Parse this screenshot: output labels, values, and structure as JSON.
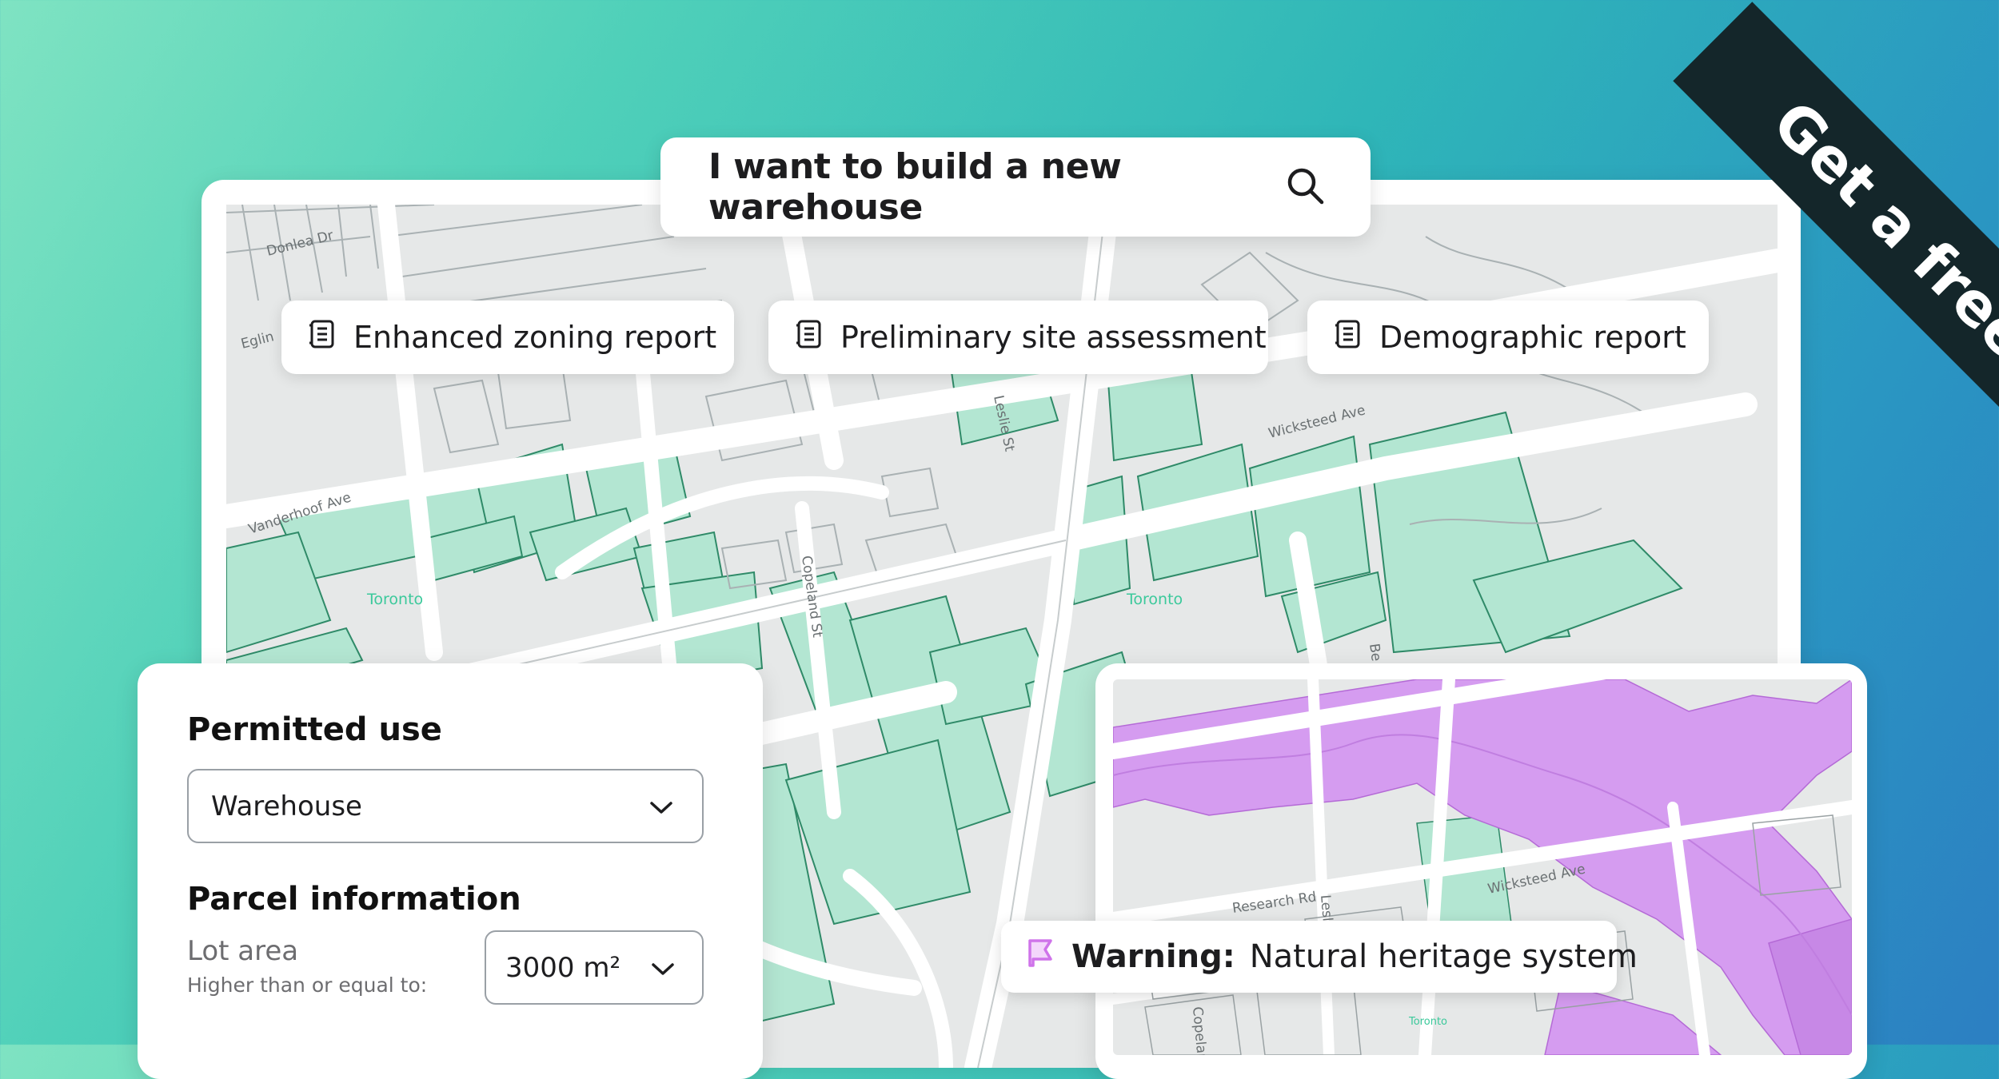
{
  "search": {
    "query": "I want to build a new warehouse",
    "icon": "search-icon"
  },
  "reports": [
    {
      "label": "Enhanced zoning report",
      "icon": "report-icon"
    },
    {
      "label": "Preliminary site assessment",
      "icon": "report-icon"
    },
    {
      "label": "Demographic report",
      "icon": "report-icon"
    }
  ],
  "banner": {
    "label": "Get a free trial!"
  },
  "map": {
    "streets": [
      "Donlea Dr",
      "Eglin",
      "Vanderhoof Ave",
      "Leslie St",
      "Wicksteed Ave",
      "Copeland St",
      "Be"
    ],
    "place_labels": [
      "Toronto",
      "Toronto"
    ],
    "colors": {
      "parcel_fill": "#b3e6d2",
      "parcel_stroke": "#2f8a68",
      "road": "#ffffff",
      "base": "#e6e8e8"
    }
  },
  "filters": {
    "permitted_use": {
      "title": "Permitted use",
      "value": "Warehouse"
    },
    "parcel_information": {
      "title": "Parcel information",
      "lot_area_label": "Lot area",
      "lot_area_hint": "Higher than or equal to:",
      "lot_area_value": "3000 m²"
    }
  },
  "heritage_map": {
    "streets": [
      "Research Rd",
      "Leslie",
      "Wicksteed Ave",
      "Copeland",
      "Toronto"
    ],
    "colors": {
      "heritage_fill": "#d59cf0",
      "parcel_fill": "#b3e6d2"
    }
  },
  "warning": {
    "prefix": "Warning:",
    "message": "Natural heritage system",
    "icon": "flag-icon",
    "color": "#cf73ea"
  }
}
